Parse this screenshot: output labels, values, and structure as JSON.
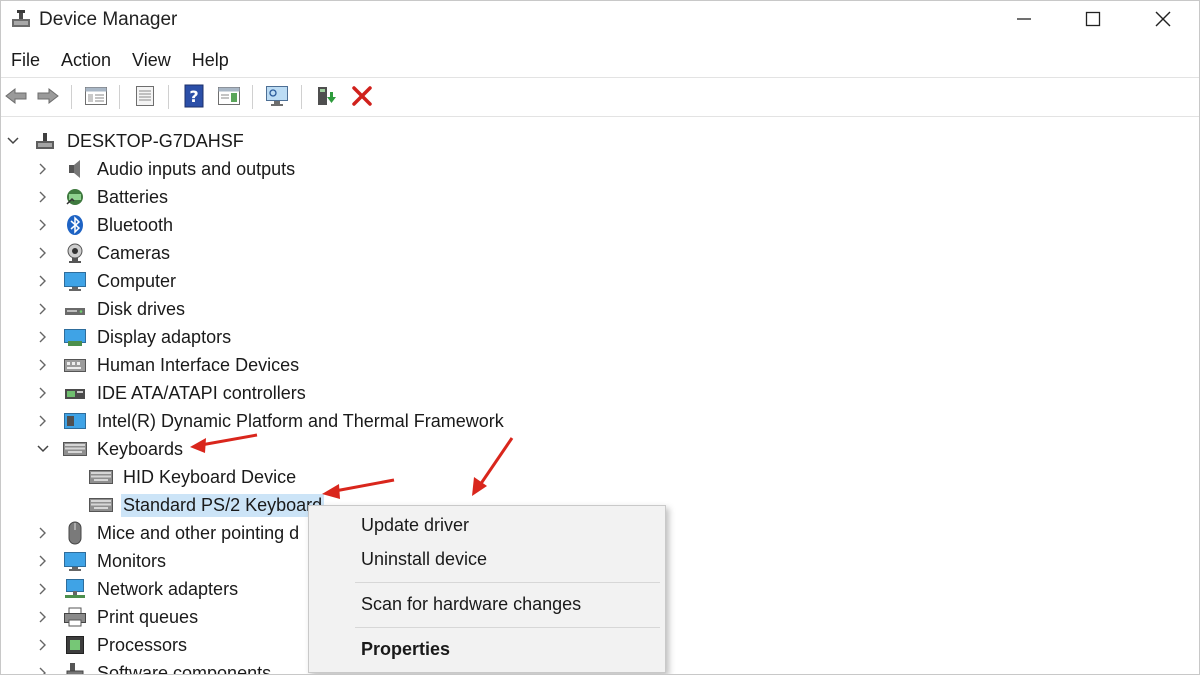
{
  "window": {
    "title": "Device Manager",
    "controls": [
      "minimize",
      "maximize",
      "close"
    ]
  },
  "menubar": {
    "items": [
      "File",
      "Action",
      "View",
      "Help"
    ]
  },
  "toolbar": {
    "icons": [
      "back-arrow-icon",
      "forward-arrow-icon",
      "show-hide-console-tree-icon",
      "properties-icon",
      "help-icon",
      "action-pane-icon",
      "scan-monitor-icon",
      "update-driver-icon",
      "uninstall-x-icon"
    ]
  },
  "tree": {
    "root": "DESKTOP-G7DAHSF",
    "categories": [
      "Audio inputs and outputs",
      "Batteries",
      "Bluetooth",
      "Cameras",
      "Computer",
      "Disk drives",
      "Display adaptors",
      "Human Interface Devices",
      "IDE ATA/ATAPI controllers",
      "Intel(R) Dynamic Platform and Thermal Framework",
      "Keyboards",
      "Mice and other pointing d",
      "Monitors",
      "Network adapters",
      "Print queues",
      "Processors",
      "Software components"
    ],
    "keyboard_children": [
      "HID Keyboard Device",
      "Standard PS/2 Keyboard"
    ]
  },
  "context_menu": {
    "update_driver": "Update driver",
    "uninstall_device": "Uninstall device",
    "scan_hardware": "Scan for hardware changes",
    "properties": "Properties"
  },
  "colors": {
    "selection": "#cce4f7",
    "annotation_arrow": "#d9261c",
    "uninstall_red": "#d0211c"
  }
}
